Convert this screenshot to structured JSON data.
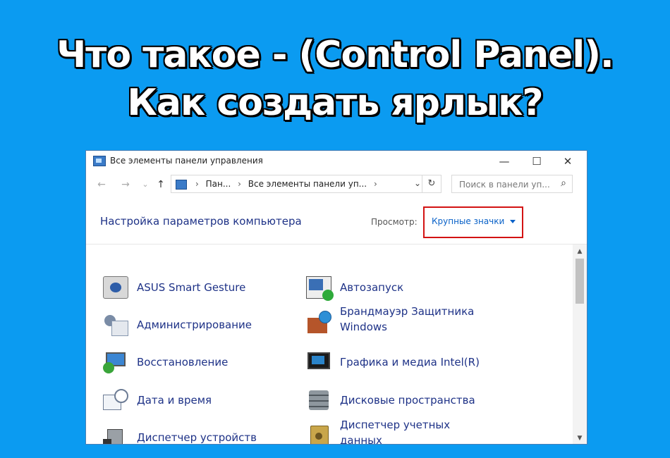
{
  "headline": {
    "line1": "Что такое - (Control Panel).",
    "line2": "Как создать ярлык?"
  },
  "window": {
    "title": "Все элементы панели управления",
    "controls": {
      "minimize": "—",
      "maximize": "☐",
      "close": "✕"
    },
    "nav": {
      "back": "←",
      "forward": "→",
      "recent": "⌄",
      "up": "↑"
    },
    "breadcrumb": [
      "Пан...",
      "Все элементы панели уп..."
    ],
    "address_dropdown": "⌄",
    "refresh": "↻",
    "search": {
      "placeholder": "Поиск в панели уп...",
      "icon": "⌕"
    },
    "settings_title": "Настройка параметров компьютера",
    "view": {
      "label": "Просмотр:",
      "value": "Крупные значки"
    },
    "items": [
      {
        "label": "ASUS Smart Gesture",
        "icon": "asus-smart-gesture-icon"
      },
      {
        "label": "Автозапуск",
        "icon": "autorun-icon"
      },
      {
        "label": "Администрирование",
        "icon": "administration-icon"
      },
      {
        "label": "Брандмауэр Защитника",
        "label2": "Windows",
        "icon": "firewall-icon"
      },
      {
        "label": "Восстановление",
        "icon": "recovery-icon"
      },
      {
        "label": "Графика и медиа Intel(R)",
        "icon": "intel-graphics-icon"
      },
      {
        "label": "Дата и время",
        "icon": "date-time-icon"
      },
      {
        "label": "Дисковые пространства",
        "icon": "storage-spaces-icon"
      },
      {
        "label": "Диспетчер устройств",
        "icon": "device-manager-icon"
      },
      {
        "label": "Диспетчер учетных",
        "label2": "данных",
        "icon": "credential-manager-icon"
      }
    ],
    "scrollbar": {
      "up": "▲",
      "down": "▼"
    }
  }
}
